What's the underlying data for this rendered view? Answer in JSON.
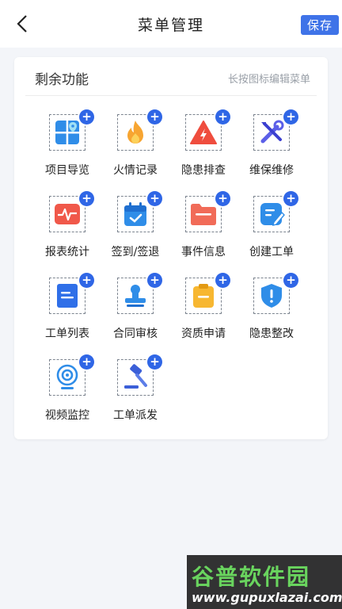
{
  "header": {
    "title": "菜单管理",
    "save_label": "保存",
    "back_icon": "chevron-left-icon"
  },
  "panel": {
    "title": "剩余功能",
    "hint": "长按图标编辑菜单"
  },
  "items": [
    {
      "label": "项目导览",
      "icon": "map-grid-icon"
    },
    {
      "label": "火情记录",
      "icon": "flame-icon"
    },
    {
      "label": "隐患排查",
      "icon": "warning-triangle-icon"
    },
    {
      "label": "维保维修",
      "icon": "tools-icon"
    },
    {
      "label": "报表统计",
      "icon": "pulse-chart-icon"
    },
    {
      "label": "签到/签退",
      "icon": "calendar-check-icon"
    },
    {
      "label": "事件信息",
      "icon": "folder-icon"
    },
    {
      "label": "创建工单",
      "icon": "edit-doc-icon"
    },
    {
      "label": "工单列表",
      "icon": "doc-list-icon"
    },
    {
      "label": "合同审核",
      "icon": "stamp-icon"
    },
    {
      "label": "资质申请",
      "icon": "clipboard-icon"
    },
    {
      "label": "隐患整改",
      "icon": "shield-alert-icon"
    },
    {
      "label": "视频监控",
      "icon": "webcam-icon"
    },
    {
      "label": "工单派发",
      "icon": "gavel-icon"
    }
  ],
  "plus_symbol": "+",
  "watermark": {
    "top": "谷普软件园",
    "bottom": "www.gupuxlazai.com"
  },
  "colors": {
    "accent": "#2f66e6",
    "save_bg": "#3f73e8"
  }
}
